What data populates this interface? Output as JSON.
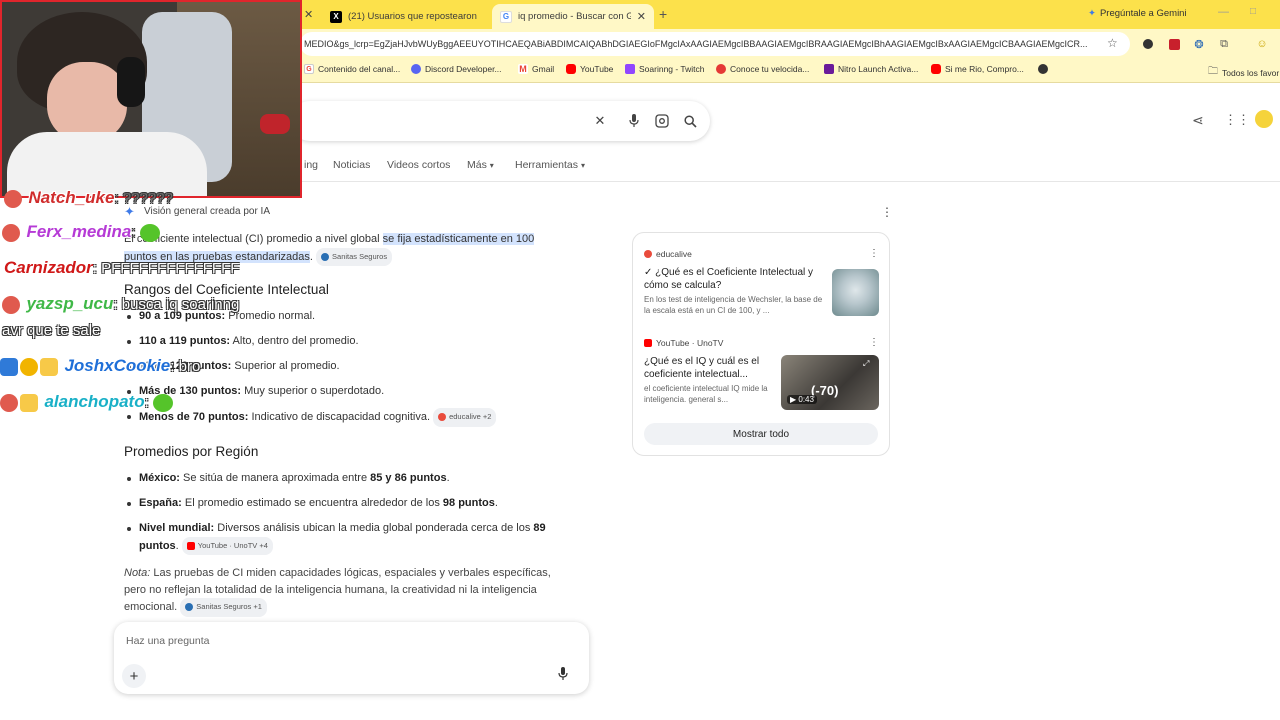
{
  "browser": {
    "tabs": [
      {
        "title": "(21) Usuarios que repostearon",
        "favicon": "X"
      },
      {
        "title": "iq promedio - Buscar con Goog",
        "favicon": "G"
      }
    ],
    "new_tab_symbol": "+",
    "gemini_label": "Pregúntale a Gemini",
    "url": "MEDIO&gs_lcrp=EgZjaHJvbWUyBggAEEUYOTIHCAEQABiABDIMCAIQABhDGIAEGIoFMgcIAxAAGIAEMgcIBBAAGIAEMgcIBRAAGIAEMgcIBhAAGIAEMgcIBxAAGIAEMgcICBAAGIAEMgcICR...",
    "bookmarks": [
      "Contenido del canal...",
      "Discord Developer...",
      "Gmail",
      "YouTube",
      "Soarinng - Twitch",
      "Conoce tu velocida...",
      "Nitro Launch Activa...",
      "Si me Rio, Compro..."
    ],
    "all_bookmarks": "Todos los favor"
  },
  "search": {
    "nav_tabs": [
      "ing",
      "Noticias",
      "Videos cortos",
      "Más",
      "Herramientas"
    ]
  },
  "ai_overview": {
    "header": "Visión general creada por IA",
    "intro_start": "El coeficiente intelectual (CI) promedio a nivel global ",
    "intro_highlight_1": "se fija estadísticamente en 100",
    "intro_highlight_2": "puntos en las pruebas estandarizadas",
    "intro_end": ".",
    "intro_source": "Sanitas Seguros",
    "section1_title": "Rangos del Coeficiente Intelectual",
    "ranges": [
      {
        "label": "90 a 109 puntos:",
        "text": " Promedio normal."
      },
      {
        "label": "110 a 119 puntos:",
        "text": " Alto, dentro del promedio."
      },
      {
        "label": "120 a 129 puntos:",
        "text": " Superior al promedio."
      },
      {
        "label": "Más de 130 puntos:",
        "text": " Muy superior o superdotado."
      },
      {
        "label": "Menos de 70 puntos:",
        "text": " Indicativo de discapacidad cognitiva."
      }
    ],
    "ranges_source": "educalive +2",
    "section2_title": "Promedios por Región",
    "regions": [
      {
        "label": "México:",
        "text": " Se sitúa de manera aproximada entre ",
        "b1": "85 y 86 puntos",
        "tail": "."
      },
      {
        "label": "España:",
        "text": " El promedio estimado se encuentra alrededor de los ",
        "b1": "98 puntos",
        "tail": "."
      },
      {
        "label": "Nivel mundial:",
        "text": " Diversos análisis ubican la media global ponderada cerca de los ",
        "b1": "89",
        "line2": "puntos",
        "tail": "."
      }
    ],
    "regions_source": "YouTube · UnoTV +4",
    "note_label": "Nota:",
    "note_line1": " Las pruebas de CI miden capacidades lógicas, espaciales y verbales específicas,",
    "note_line2": "pero no reflejan la totalidad de la inteligencia humana, la creatividad ni la inteligencia",
    "note_line3": "emocional.",
    "note_source": "Sanitas Seguros +1",
    "ask_placeholder": "Haz una pregunta"
  },
  "sources": [
    {
      "site": "educalive",
      "title": "✓ ¿Qué es el Coeficiente Intelectual y cómo se calcula?",
      "snippet": "En los test de inteligencia de Wechsler, la base de la escala está en un CI de 100, y ..."
    },
    {
      "site": "YouTube · UnoTV",
      "title": "¿Qué es el IQ y cuál es el coeficiente intelectual...",
      "snippet": "el coeficiente intelectual IQ mide la inteligencia. general s...",
      "video_overlay": "(-70)",
      "duration": "0:43"
    }
  ],
  "show_all": "Mostrar todo",
  "stream_chat": [
    {
      "name": "Natch_uke",
      "message": ": ??????"
    },
    {
      "name": "Ferx_medina",
      "message": ":"
    },
    {
      "name": "Carnizador",
      "message": ": PFFFFFFFFFFFFFF"
    },
    {
      "name": "yazsp_ucu",
      "message": ": busca iq soarinng"
    },
    {
      "name": "",
      "message": "avr que te sale"
    },
    {
      "name": "JoshxCookie",
      "message": ": bro"
    },
    {
      "name": "alanchopato",
      "message": ":"
    }
  ],
  "colors": {
    "tabstrip": "#fce14b",
    "toolbar": "#fff8c6",
    "highlight": "#d3e3fd",
    "cam_border": "#e0252c",
    "ferx": "#b63bd6",
    "carnizador": "#d01818",
    "yazsp": "#3fb847",
    "joshx": "#1f6fd8",
    "alancho": "#19b0c7"
  }
}
